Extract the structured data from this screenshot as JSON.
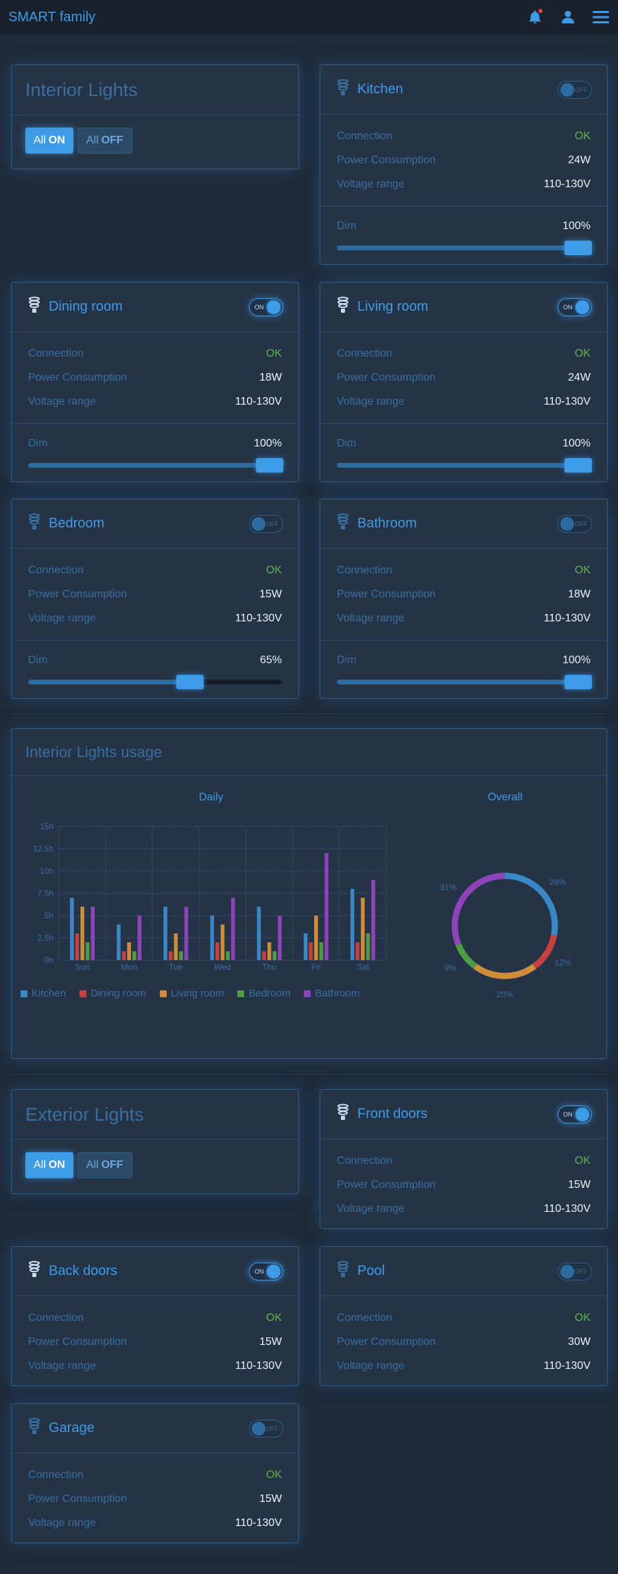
{
  "app": {
    "title": "SMART family"
  },
  "interior": {
    "title": "Interior Lights",
    "all_on": {
      "pre": "All",
      "strong": "ON"
    },
    "all_off": {
      "pre": "All",
      "strong": "OFF"
    }
  },
  "exterior": {
    "title": "Exterior Lights",
    "all_on": {
      "pre": "All",
      "strong": "ON"
    },
    "all_off": {
      "pre": "All",
      "strong": "OFF"
    }
  },
  "labels": {
    "connection": "Connection",
    "power": "Power Consumption",
    "voltage": "Voltage range",
    "dim": "Dim",
    "toggle_on": "ON",
    "toggle_off": "OFF"
  },
  "rooms": {
    "kitchen": {
      "name": "Kitchen",
      "on": false,
      "connection": "OK",
      "power": "24W",
      "voltage": "110-130V",
      "dim_text": "100%",
      "dim": 1.0
    },
    "dining": {
      "name": "Dining room",
      "on": true,
      "connection": "OK",
      "power": "18W",
      "voltage": "110-130V",
      "dim_text": "100%",
      "dim": 1.0
    },
    "living": {
      "name": "Living room",
      "on": true,
      "connection": "OK",
      "power": "24W",
      "voltage": "110-130V",
      "dim_text": "100%",
      "dim": 1.0
    },
    "bedroom": {
      "name": "Bedroom",
      "on": false,
      "connection": "OK",
      "power": "15W",
      "voltage": "110-130V",
      "dim_text": "65%",
      "dim": 0.65
    },
    "bathroom": {
      "name": "Bathroom",
      "on": false,
      "connection": "OK",
      "power": "18W",
      "voltage": "110-130V",
      "dim_text": "100%",
      "dim": 1.0
    },
    "front": {
      "name": "Front doors",
      "on": true,
      "connection": "OK",
      "power": "15W",
      "voltage": "110-130V"
    },
    "back": {
      "name": "Back doors",
      "on": true,
      "connection": "OK",
      "power": "15W",
      "voltage": "110-130V"
    },
    "pool": {
      "name": "Pool",
      "on": false,
      "connection": "OK",
      "power": "30W",
      "voltage": "110-130V"
    },
    "garage": {
      "name": "Garage",
      "on": false,
      "connection": "OK",
      "power": "15W",
      "voltage": "110-130V"
    }
  },
  "usage": {
    "title": "Interior Lights usage",
    "daily_title": "Daily",
    "overall_title": "Overall"
  },
  "colors": {
    "accent": "#3d9be8",
    "kitchen": "#3a87c8",
    "dining": "#c8413f",
    "living": "#cf8d3a",
    "bedroom": "#4f9a45",
    "bathroom": "#8e44b8"
  },
  "icons": {
    "bell": "bell-icon",
    "user": "user-icon",
    "menu": "menu-icon",
    "bulb": "bulb-icon"
  },
  "chart_data": [
    {
      "type": "bar",
      "title": "Daily",
      "categories": [
        "Sun",
        "Mon",
        "Tue",
        "Wed",
        "Thu",
        "Fri",
        "Sat"
      ],
      "y_ticks": [
        "0h",
        "2.5h",
        "5h",
        "7.5h",
        "10h",
        "12.5h",
        "15h"
      ],
      "ylim": [
        0,
        15
      ],
      "series": [
        {
          "name": "Kitchen",
          "values": [
            7,
            4,
            6,
            5,
            6,
            3,
            8
          ]
        },
        {
          "name": "Dining room",
          "values": [
            3,
            1,
            1,
            2,
            1,
            2,
            2
          ]
        },
        {
          "name": "Living room",
          "values": [
            6,
            2,
            3,
            4,
            2,
            5,
            7
          ]
        },
        {
          "name": "Bedroom",
          "values": [
            2,
            1,
            1,
            1,
            1,
            2,
            3
          ]
        },
        {
          "name": "Bathroom",
          "values": [
            6,
            5,
            6,
            7,
            5,
            12,
            9
          ]
        }
      ],
      "legend": "bottom-left",
      "grid": true
    },
    {
      "type": "pie",
      "title": "Overall",
      "slices": [
        {
          "name": "Kitchen",
          "value": 28,
          "label": "28%"
        },
        {
          "name": "Dining room",
          "value": 12,
          "label": "12%"
        },
        {
          "name": "Living room",
          "value": 20,
          "label": "20%"
        },
        {
          "name": "Bedroom",
          "value": 9,
          "label": "9%"
        },
        {
          "name": "Bathroom",
          "value": 31,
          "label": "31%"
        }
      ]
    }
  ]
}
